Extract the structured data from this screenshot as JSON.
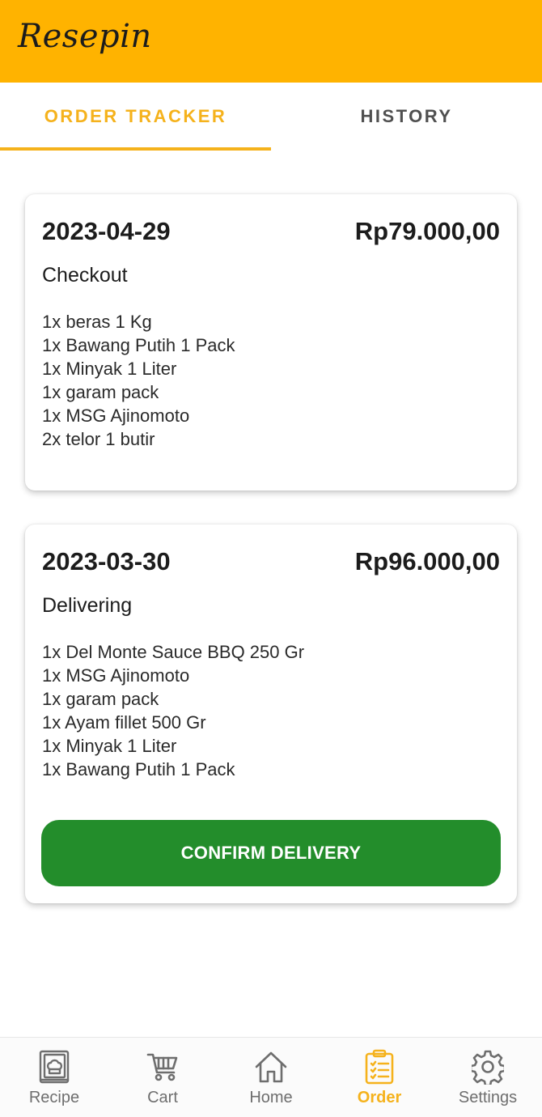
{
  "app": {
    "logo_text": "Resepin",
    "brand_color": "#ffb300",
    "accent_color": "#f5b21c",
    "confirm_color": "#238d2b"
  },
  "tabs": [
    {
      "label": "ORDER TRACKER",
      "active": true
    },
    {
      "label": "HISTORY",
      "active": false
    }
  ],
  "orders": [
    {
      "date": "2023-04-29",
      "total": "Rp79.000,00",
      "status": "Checkout",
      "items": [
        "1x beras 1 Kg",
        "1x Bawang Putih 1 Pack",
        "1x Minyak 1 Liter",
        "1x garam pack",
        "1x MSG Ajinomoto",
        "2x telor 1 butir"
      ]
    },
    {
      "date": "2023-03-30",
      "total": "Rp96.000,00",
      "status": "Delivering",
      "items": [
        "1x Del Monte Sauce BBQ 250 Gr",
        "1x MSG Ajinomoto",
        "1x garam pack",
        "1x Ayam fillet 500 Gr",
        "1x Minyak 1 Liter",
        "1x Bawang Putih 1 Pack"
      ],
      "action_label": "CONFIRM DELIVERY"
    }
  ],
  "bottom_nav": [
    {
      "label": "Recipe",
      "icon": "recipe-book-icon",
      "active": false
    },
    {
      "label": "Cart",
      "icon": "cart-icon",
      "active": false
    },
    {
      "label": "Home",
      "icon": "home-icon",
      "active": false
    },
    {
      "label": "Order",
      "icon": "clipboard-list-icon",
      "active": true
    },
    {
      "label": "Settings",
      "icon": "gear-icon",
      "active": false
    }
  ]
}
